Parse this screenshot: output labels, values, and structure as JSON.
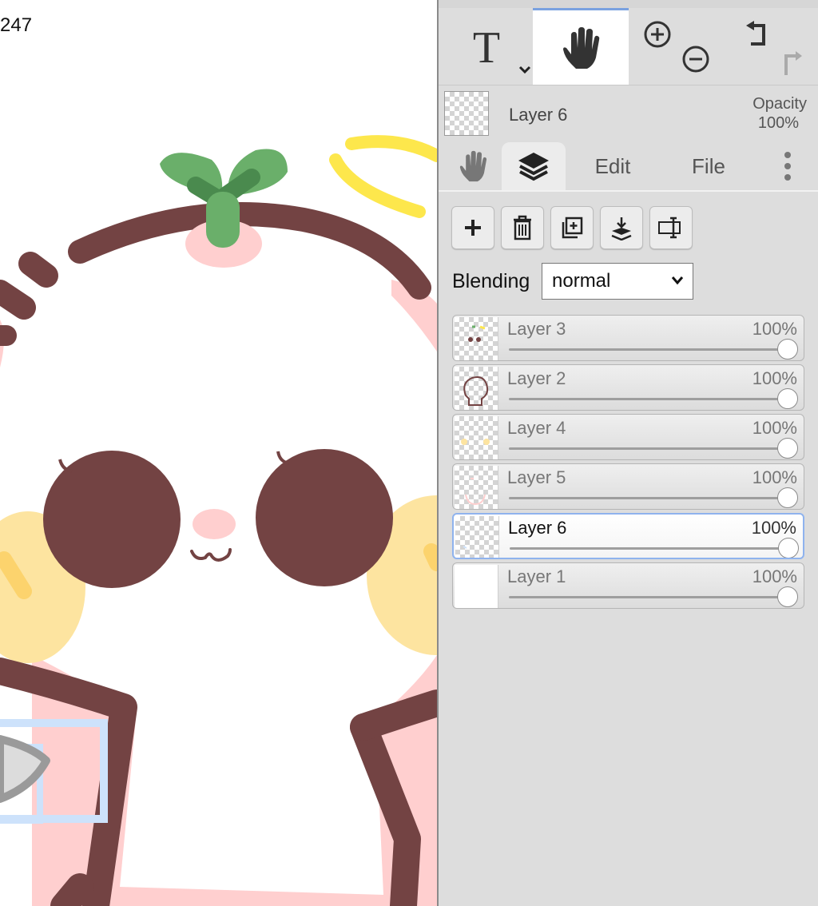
{
  "canvas": {
    "coordinate_readout": "247"
  },
  "toolbar": {
    "tools": [
      {
        "name": "text-tool",
        "icon": "text-T-icon",
        "active": false
      },
      {
        "name": "hand-tool",
        "icon": "hand-icon",
        "active": true
      },
      {
        "name": "zoom-tool",
        "icon": "zoom-in-out-icon",
        "active": false
      },
      {
        "name": "undo-redo",
        "icon": "undo-redo-icon",
        "active": false
      }
    ]
  },
  "current_layer": {
    "name": "Layer 6",
    "opacity_label": "Opacity",
    "opacity_value": "100%"
  },
  "tabs": {
    "edit": "Edit",
    "file": "File",
    "active": "layers"
  },
  "layer_buttons": [
    "add-layer",
    "delete-layer",
    "duplicate-layer",
    "merge-down",
    "rename-layer"
  ],
  "blending": {
    "label": "Blending",
    "value": "normal"
  },
  "layers": [
    {
      "name": "Layer 3",
      "opacity": "100%",
      "selected": false,
      "opacity_fraction": 1.0
    },
    {
      "name": "Layer 2",
      "opacity": "100%",
      "selected": false,
      "opacity_fraction": 1.0
    },
    {
      "name": "Layer 4",
      "opacity": "100%",
      "selected": false,
      "opacity_fraction": 1.0
    },
    {
      "name": "Layer 5",
      "opacity": "100%",
      "selected": false,
      "opacity_fraction": 1.0
    },
    {
      "name": "Layer 6",
      "opacity": "100%",
      "selected": true,
      "opacity_fraction": 1.0
    },
    {
      "name": "Layer 1",
      "opacity": "100%",
      "selected": false,
      "opacity_fraction": 1.0
    }
  ],
  "colors": {
    "accent": "#8fb3ee",
    "outline": "#734343",
    "leaf": "#6aaf6a",
    "cheek": "#fde4a0",
    "pink": "#ffcfcf",
    "halo": "#fde74c"
  }
}
